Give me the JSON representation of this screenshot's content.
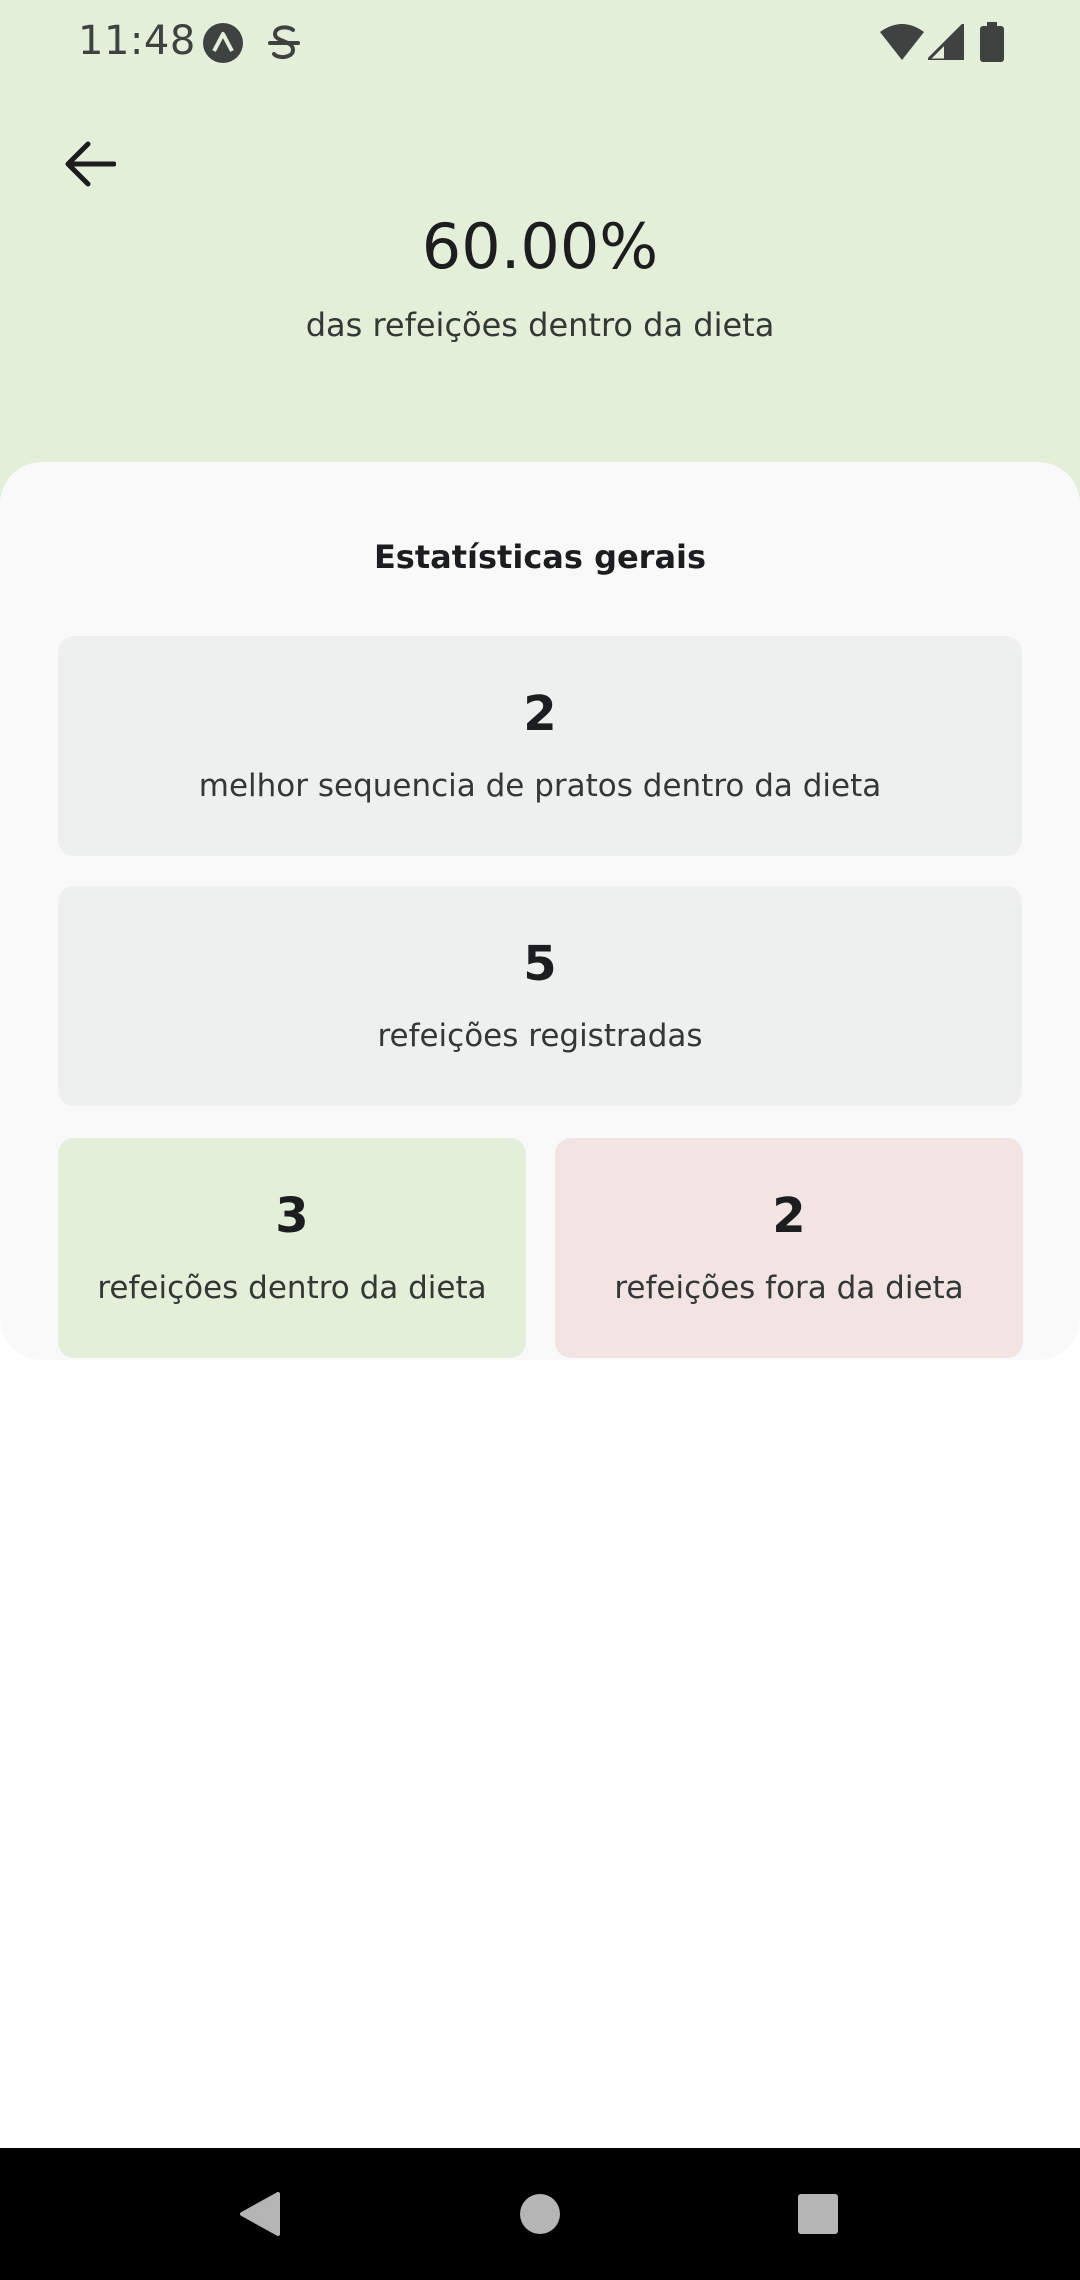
{
  "status_bar": {
    "time": "11:48",
    "icons": [
      "app-a-icon",
      "app-s-icon",
      "wifi-icon",
      "signal-icon",
      "battery-icon"
    ]
  },
  "header": {
    "percentage": "60.00%",
    "caption": "das refeições dentro da dieta",
    "background_color": "#E4EFD9"
  },
  "stats": {
    "title": "Estatísticas gerais",
    "best_sequence": {
      "value": "2",
      "label": "melhor sequencia de pratos dentro da dieta"
    },
    "registered": {
      "value": "5",
      "label": "refeições registradas"
    },
    "in_diet": {
      "value": "3",
      "label": "refeições dentro da dieta",
      "color": "#E4EFD9"
    },
    "off_diet": {
      "value": "2",
      "label": "refeições fora da dieta",
      "color": "#F3E4E4"
    }
  },
  "navigation": {
    "buttons": [
      "back-triangle-icon",
      "home-circle-icon",
      "recents-square-icon"
    ]
  }
}
